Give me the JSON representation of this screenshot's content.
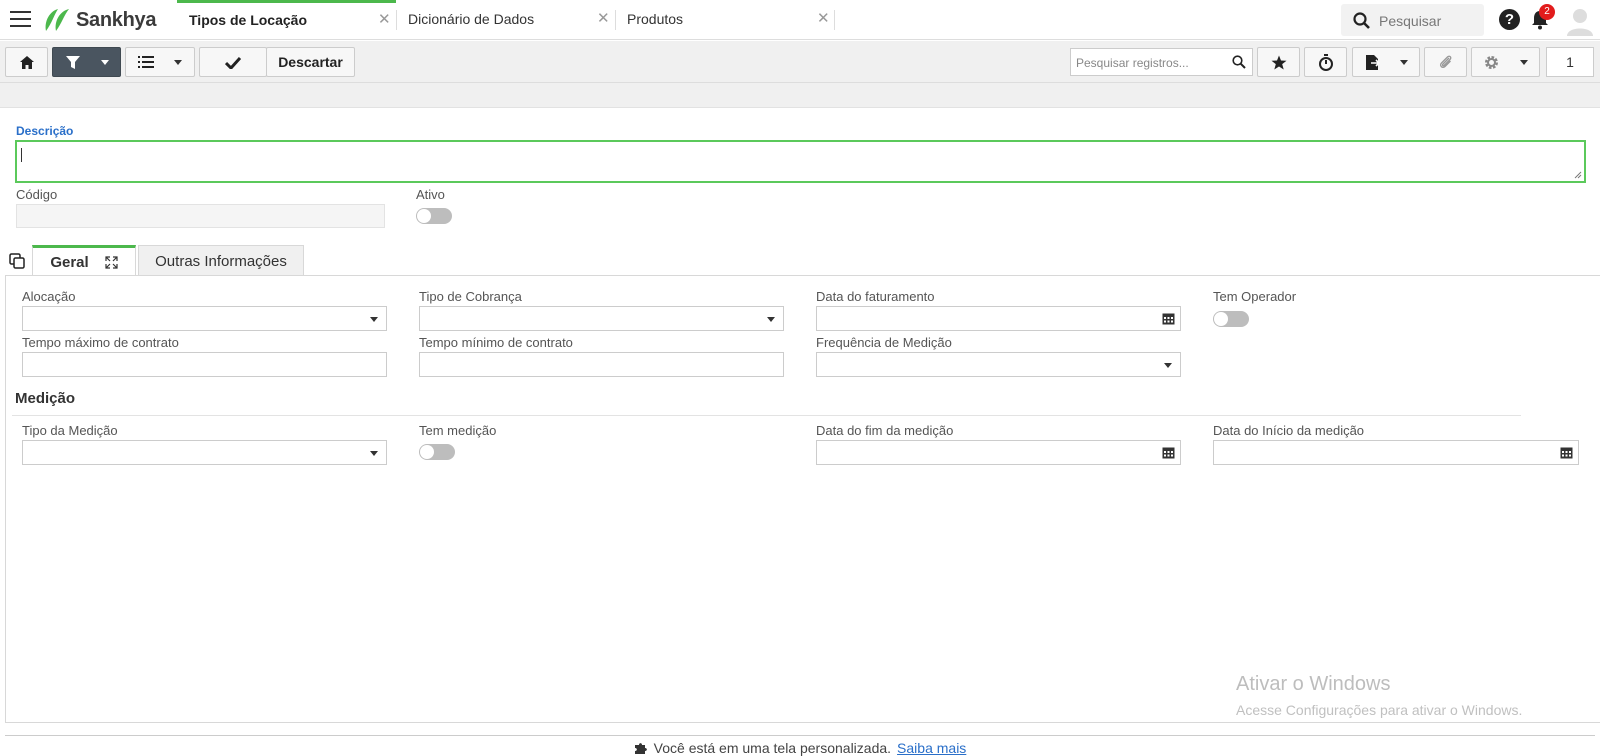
{
  "app": {
    "name": "Sankhya"
  },
  "tabs": [
    {
      "label": "Tipos de Locação",
      "active": true
    },
    {
      "label": "Dicionário de Dados",
      "active": false
    },
    {
      "label": "Produtos",
      "active": false
    }
  ],
  "topbar": {
    "search_placeholder": "Pesquisar",
    "help": "?",
    "notification_count": "2"
  },
  "toolbar": {
    "discard_label": "Descartar",
    "records_search_placeholder": "Pesquisar registros...",
    "page_number": "1"
  },
  "form": {
    "descricao_label": "Descrição",
    "codigo_label": "Código",
    "ativo_label": "Ativo"
  },
  "form_tabs": [
    {
      "label": "Geral",
      "active": true
    },
    {
      "label": "Outras Informações",
      "active": false
    }
  ],
  "geral": {
    "alocacao": "Alocação",
    "tipo_cobranca": "Tipo de Cobrança",
    "data_faturamento": "Data do faturamento",
    "tem_operador": "Tem Operador",
    "tempo_maximo": "Tempo máximo de contrato",
    "tempo_minimo": "Tempo mínimo de contrato",
    "frequencia_medicao": "Frequência de Medição"
  },
  "medicao": {
    "section_title": "Medição",
    "tipo_medicao": "Tipo da Medição",
    "tem_medicao": "Tem medição",
    "data_fim": "Data do fim da medição",
    "data_inicio": "Data do Início da medição"
  },
  "watermark": {
    "line1": "Ativar o Windows",
    "line2": "Acesse Configurações para ativar o Windows."
  },
  "footer": {
    "text": "Você está em uma tela personalizada.",
    "link": "Saiba mais"
  },
  "colors": {
    "accent_green": "#4cb84c",
    "focus_blue": "#2a6fc9",
    "badge_red": "#e21c1c"
  }
}
